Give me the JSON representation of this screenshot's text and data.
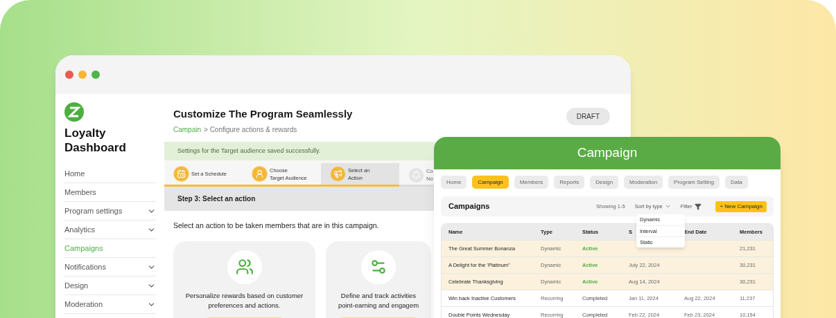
{
  "back_window": {
    "sidebar": {
      "title": "Loyalty Dashboard",
      "items": [
        {
          "label": "Home",
          "selected": false,
          "expandable": false
        },
        {
          "label": "Members",
          "selected": false,
          "expandable": false
        },
        {
          "label": "Program settings",
          "selected": false,
          "expandable": true
        },
        {
          "label": "Analytics",
          "selected": false,
          "expandable": true
        },
        {
          "label": "Campaigns",
          "selected": true,
          "expandable": false
        },
        {
          "label": "Notifications",
          "selected": false,
          "expandable": true
        },
        {
          "label": "Design",
          "selected": false,
          "expandable": true
        },
        {
          "label": "Moderation",
          "selected": false,
          "expandable": true
        }
      ]
    },
    "header": {
      "title": "Customize The Program Seamlessly",
      "breadcrumb_link": "Campain",
      "breadcrumb_rest": "> Configure actions & rewards",
      "status_button": "DRAFT"
    },
    "banner": "Settings for the Target audience saved successfully.",
    "steps": [
      {
        "lines": [
          "Set a Schedule"
        ],
        "completed": true,
        "selected": false
      },
      {
        "lines": [
          "Choose",
          "Target Audience"
        ],
        "completed": true,
        "selected": false
      },
      {
        "lines": [
          "Select an",
          "Action"
        ],
        "completed": true,
        "selected": true
      },
      {
        "lines": [
          "Co",
          "No"
        ],
        "completed": false,
        "selected": false
      }
    ],
    "step_heading": "Step 3: Select an action",
    "instruction": "Select an action to be taken members that are in this campaign.",
    "action_cards": [
      {
        "lines": [
          "Personalize rewards based on customer",
          "preferences and actions."
        ]
      },
      {
        "lines": [
          "Define and track activities",
          "point-earning and engagem"
        ]
      }
    ]
  },
  "campaign_window": {
    "title": "Campaign",
    "tabs": [
      {
        "label": "Home",
        "selected": false
      },
      {
        "label": "Campaign",
        "selected": true
      },
      {
        "label": "Members",
        "selected": false
      },
      {
        "label": "Reports",
        "selected": false
      },
      {
        "label": "Design",
        "selected": false
      },
      {
        "label": "Moderation",
        "selected": false
      },
      {
        "label": "Program Setting",
        "selected": false
      },
      {
        "label": "Data",
        "selected": false
      }
    ],
    "toolbar": {
      "title": "Campaigns",
      "showing": "Showing 1-5",
      "sort": "Sort by type",
      "filter": "Filter",
      "new_button": "+ New Campaign"
    },
    "sort_menu": [
      "Dynamic",
      "Interval",
      "Static"
    ],
    "table": {
      "columns": [
        "Name",
        "Type",
        "Status",
        "S",
        "End Date",
        "Members"
      ],
      "rows": [
        {
          "highlighted": true,
          "active": true,
          "cells": [
            "The Great Summer Bonanza",
            "Dynamic",
            "Active",
            null,
            null,
            "21,231"
          ]
        },
        {
          "highlighted": true,
          "active": true,
          "cells": [
            "A Delight for the 'Platinum\"",
            "Dynamic",
            "Active",
            "July 22, 2024",
            null,
            "30,231"
          ]
        },
        {
          "highlighted": true,
          "active": true,
          "cells": [
            "Celebrate Thanksgiving",
            "Dynamic",
            "Active",
            "Aug 14, 2024",
            null,
            "30,231"
          ]
        },
        {
          "highlighted": false,
          "active": false,
          "cells": [
            "Win back Inactive Customers",
            "Recurring",
            "Completed",
            "Jan 11, 2024",
            "Aug 22, 2024",
            "11,237"
          ]
        },
        {
          "highlighted": false,
          "active": false,
          "cells": [
            "Double Points Wednesday",
            "Recurring",
            "Completed",
            "Feb 22, 2024",
            "Feb 23, 2024",
            "10,154"
          ]
        }
      ]
    }
  }
}
